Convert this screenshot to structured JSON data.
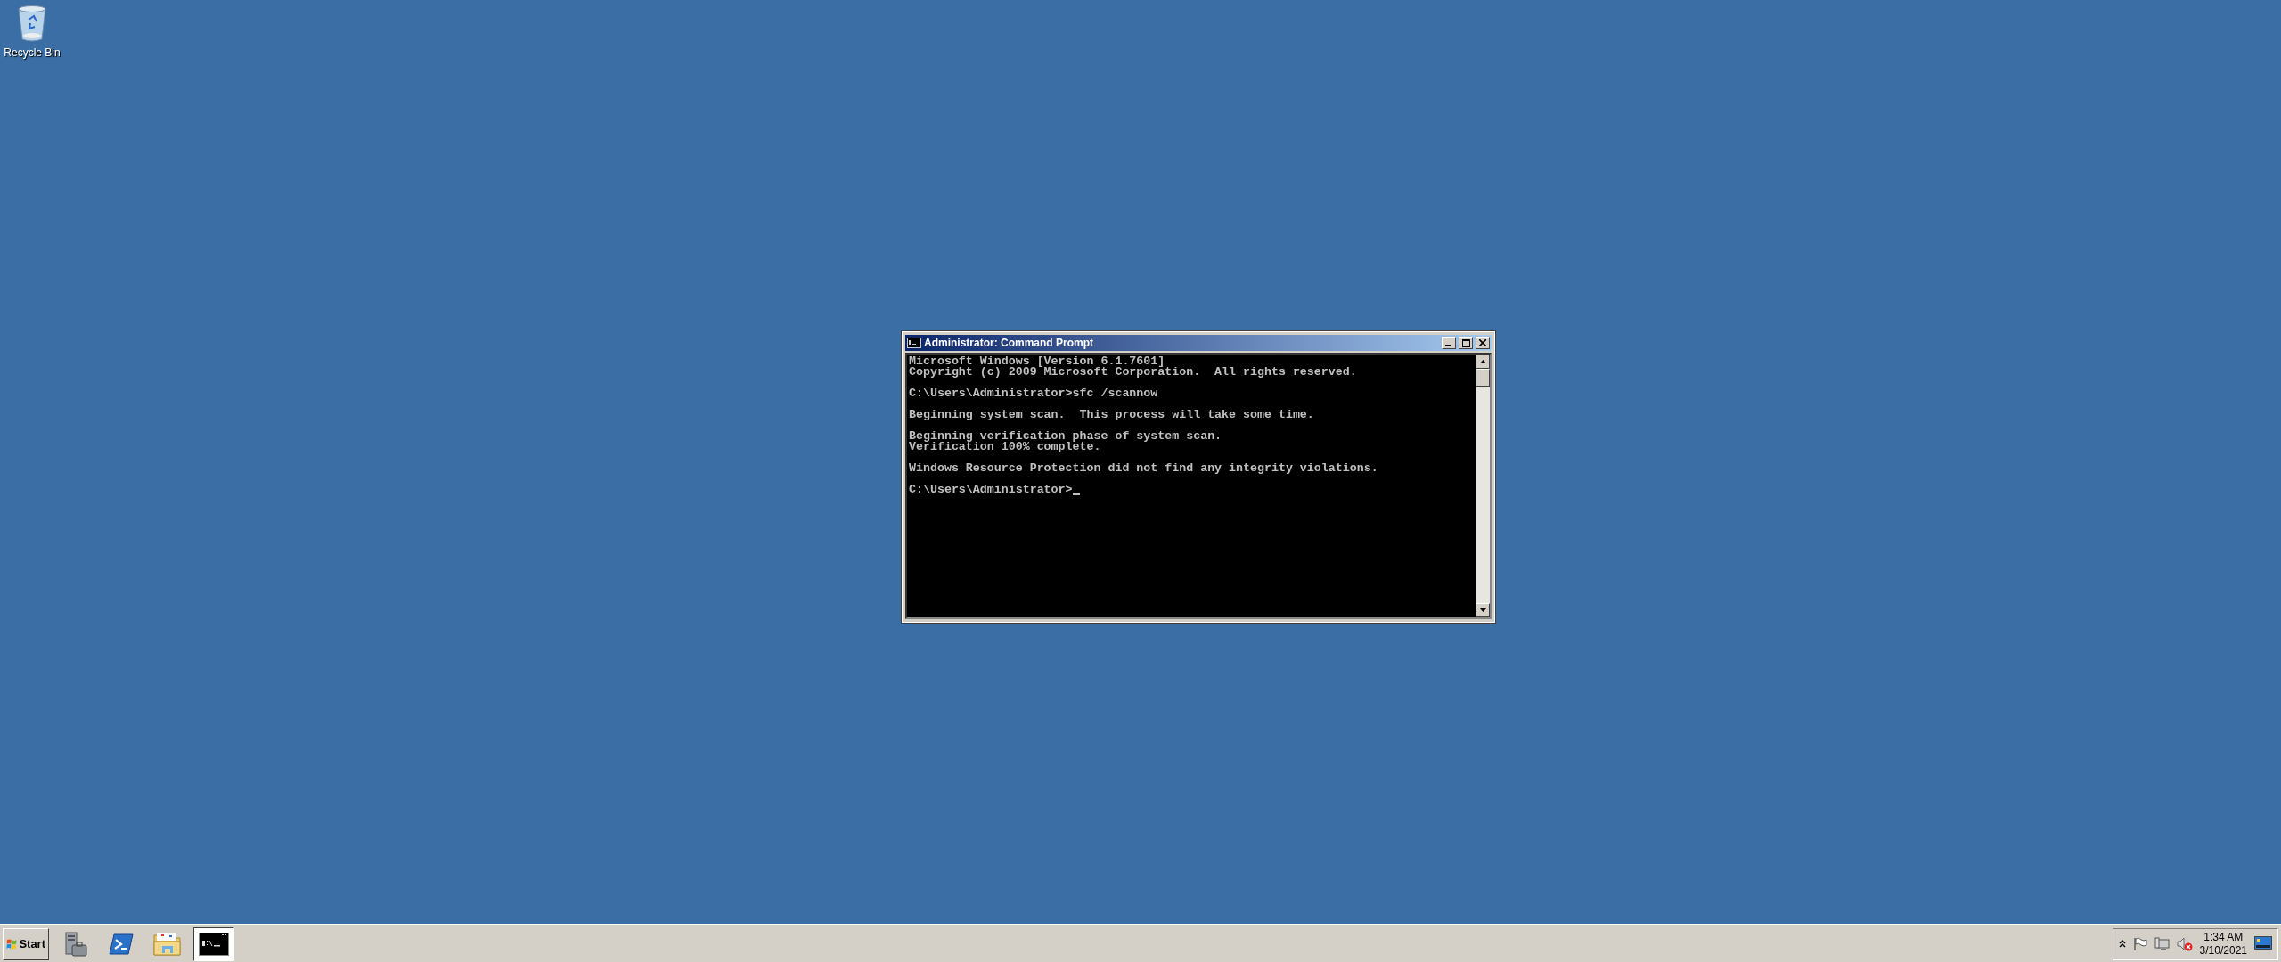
{
  "desktop_icons": [
    {
      "label": "Recycle Bin"
    }
  ],
  "window": {
    "title": "Administrator: Command Prompt",
    "active": true,
    "paragraphs": [
      [
        "Microsoft Windows [Version 6.1.7601]",
        "Copyright (c) 2009 Microsoft Corporation.  All rights reserved."
      ],
      [
        "C:\\Users\\Administrator>sfc /scannow"
      ],
      [
        "Beginning system scan.  This process will take some time."
      ],
      [
        "Beginning verification phase of system scan.",
        "Verification 100% complete."
      ],
      [
        "Windows Resource Protection did not find any integrity violations."
      ],
      [
        "C:\\Users\\Administrator>"
      ]
    ]
  },
  "taskbar": {
    "start_label": "Start",
    "items": [
      {
        "kind": "server",
        "selected": false
      },
      {
        "kind": "shell",
        "selected": false
      },
      {
        "kind": "folder",
        "selected": false
      },
      {
        "kind": "console",
        "selected": true
      }
    ],
    "clock": {
      "time": "1:34 AM",
      "date": "3/10/2021"
    }
  }
}
